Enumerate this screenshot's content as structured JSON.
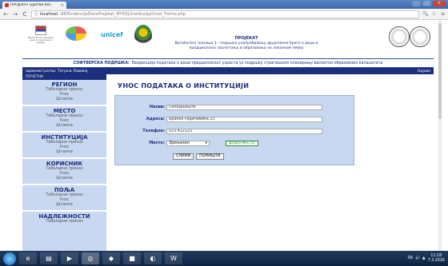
{
  "browser": {
    "tab_title": "ПРОЈЕКАТ Бритви без",
    "tab_close": "×",
    "url_host": "localhost",
    "url_path": ":88/EvidencijaDeceProjekat_MY5QL/Institucija/Unos_Forma.php",
    "back": "←",
    "forward": "→",
    "reload": "C",
    "info": "ⓘ",
    "window_minimize": "–",
    "window_maximize": "□",
    "window_close": "×"
  },
  "banner": {
    "ministry_text": "Министарство просвете, науке и технолошког развоја",
    "unicef": "unicef",
    "project_title": "ПРОЈЕКАТ",
    "project_desc_1": "Вртићи без граница 3 - подршка унапређивању друштвене бриге о деци и",
    "project_desc_2": "предшколског васпитања и образовања на локалном нивоу"
  },
  "subtitle": {
    "label": "СОФТВЕРСКА ПОДРШКА:",
    "text": "Евиденција података о деци предшколског узраста уз подршку стратешком планирању васпитно-образовних капацитета"
  },
  "userbar": {
    "user": "администратор: Татјана Ловиќој",
    "logout": "Одјава"
  },
  "sidebar": {
    "home": "ПОЧЕТНА",
    "sections": [
      {
        "head": "РЕГИОН",
        "links": [
          "Табеларни приказ",
          "Унос",
          "Штампа"
        ]
      },
      {
        "head": "МЕСТО",
        "links": [
          "Табеларни приказ",
          "Унос",
          "Штампа"
        ]
      },
      {
        "head": "ИНСТИТУЦИЈА",
        "links": [
          "Табеларни приказ",
          "Унос",
          "Штампа"
        ]
      },
      {
        "head": "КОРИСНИК",
        "links": [
          "Табеларни приказ",
          "Унос",
          "Штампа"
        ]
      },
      {
        "head": "ПОЉА",
        "links": [
          "Табеларни приказ",
          "Унос",
          "Штампа"
        ]
      },
      {
        "head": "НАДЛЕЖНОСТИ",
        "links": [
          "Табеларни приказ"
        ]
      }
    ]
  },
  "form": {
    "title": "УНОС ПОДАТАКА О ИНСТИТУЦИЈИ",
    "name_label": "Назив:",
    "name_value": "Поподњиште",
    "address_label": "Адреса:",
    "address_value": "Бранка Радичевића 23",
    "phone_label": "Телефон:",
    "phone_value": "023 412123",
    "place_label": "Место:",
    "place_value": "Зрењанин",
    "add_place": "ДОДАЈ МЕСТО",
    "save": "СНИМИ",
    "reset": "ПОНИШТИ"
  },
  "taskbar": {
    "lang": "SR",
    "time": "11:18",
    "date": "7.3.2016"
  },
  "colors": {
    "navy": "#1c2e7e",
    "sidebar_bg": "#c8d8f0",
    "add_place_green": "#2e8b2e"
  }
}
